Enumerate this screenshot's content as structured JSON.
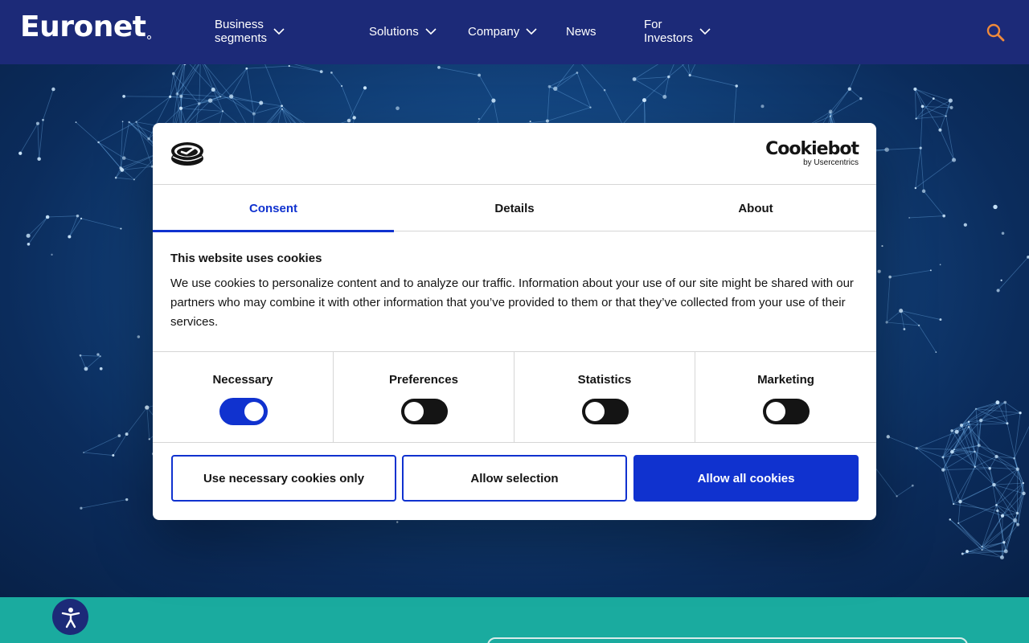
{
  "header": {
    "logo_text": "Euronet",
    "nav": [
      {
        "label": "Business segments",
        "has_dropdown": true
      },
      {
        "label": "Solutions",
        "has_dropdown": true
      },
      {
        "label": "Company",
        "has_dropdown": true
      },
      {
        "label": "News",
        "has_dropdown": false
      },
      {
        "label": "For Investors",
        "has_dropdown": true
      }
    ],
    "search_icon": "search-icon"
  },
  "dialog": {
    "brand_title": "Cookiebot",
    "brand_sub": "by Usercentrics",
    "tabs": [
      {
        "label": "Consent",
        "active": true
      },
      {
        "label": "Details",
        "active": false
      },
      {
        "label": "About",
        "active": false
      }
    ],
    "title": "This website uses cookies",
    "text": "We use cookies to personalize content and to analyze our traffic. Information about your use of our site might be shared with our partners who may combine it with other information that you’ve provided to them or that they’ve collected from your use of their services.",
    "toggles": [
      {
        "label": "Necessary",
        "on": true
      },
      {
        "label": "Preferences",
        "on": false
      },
      {
        "label": "Statistics",
        "on": false
      },
      {
        "label": "Marketing",
        "on": false
      }
    ],
    "buttons": {
      "necessary_only": "Use necessary cookies only",
      "allow_selection": "Allow selection",
      "allow_all": "Allow all cookies"
    }
  },
  "colors": {
    "header_bg": "#1c2a78",
    "accent": "#1032cf",
    "teal": "#1aab9f",
    "search_orange": "#f08a3a"
  }
}
